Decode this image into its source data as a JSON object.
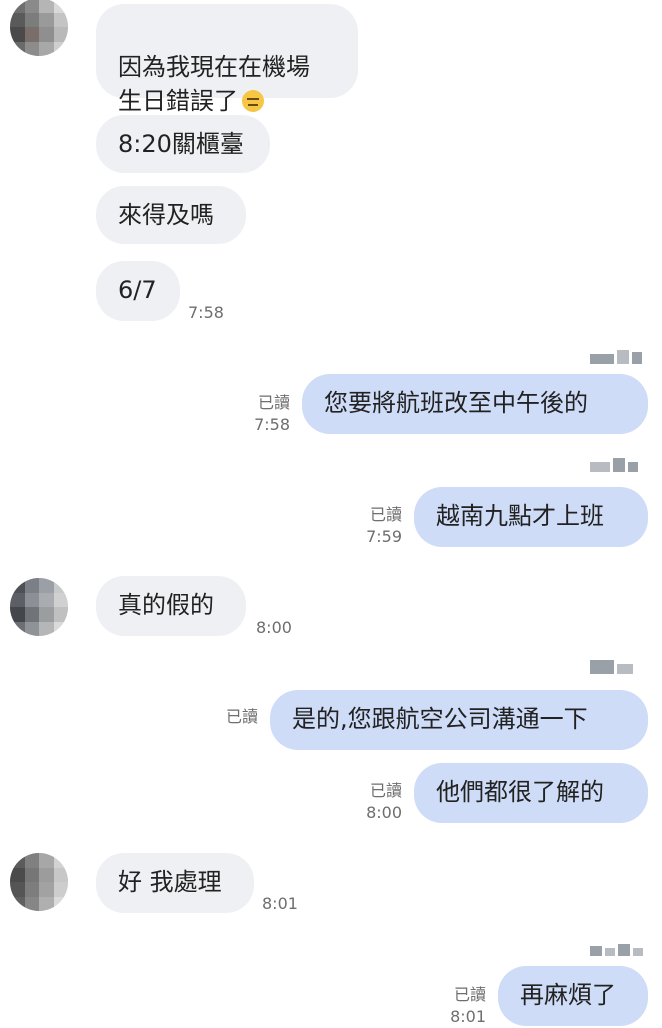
{
  "messages": [
    {
      "side": "in",
      "text": "因為我現在在機場\n生日錯誤了",
      "emoji": "expressionless-face-icon",
      "time": ""
    },
    {
      "side": "in",
      "text": "8:20關櫃臺",
      "time": ""
    },
    {
      "side": "in",
      "text": "來得及嗎",
      "time": ""
    },
    {
      "side": "in",
      "text": "6/7",
      "time": "7:58"
    },
    {
      "side": "out",
      "text": "您要將航班改至中午後的",
      "read": "已讀",
      "time": "7:58"
    },
    {
      "side": "out",
      "text": "越南九點才上班",
      "read": "已讀",
      "time": "7:59"
    },
    {
      "side": "in",
      "text": "真的假的",
      "time": "8:00"
    },
    {
      "side": "out",
      "text": "是的,您跟航空公司溝通一下",
      "read": "已讀",
      "time": ""
    },
    {
      "side": "out",
      "text": "他們都很了解的",
      "read": "已讀",
      "time": "8:00"
    },
    {
      "side": "in",
      "text": "好 我處理",
      "time": "8:01"
    },
    {
      "side": "out",
      "text": "再麻煩了",
      "read": "已讀",
      "time": "8:01"
    }
  ]
}
